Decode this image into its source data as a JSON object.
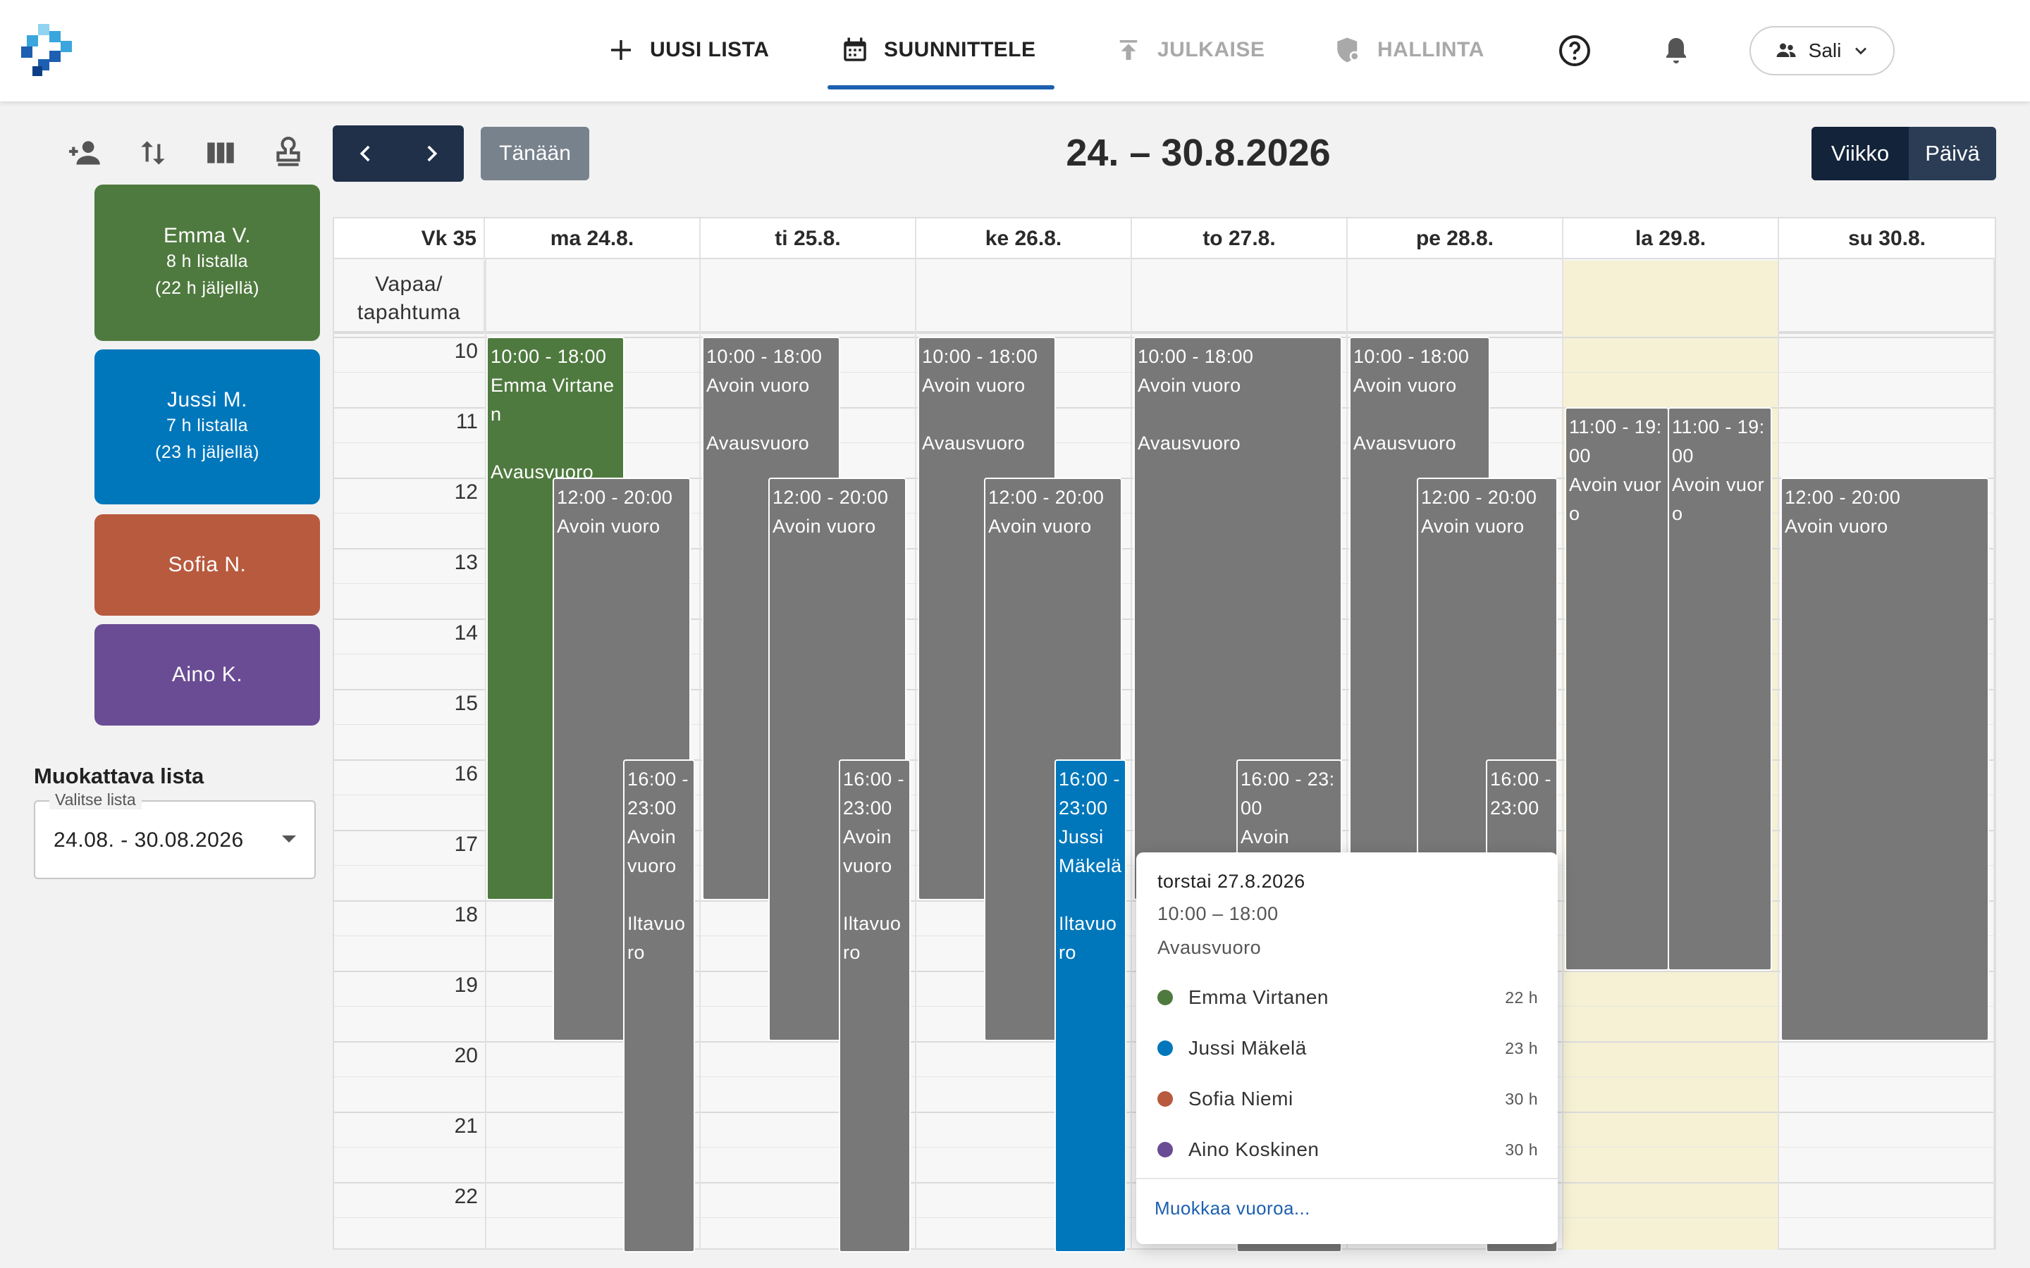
{
  "nav": {
    "new_list": "UUSI LISTA",
    "plan": "SUUNNITTELE",
    "publish": "JULKAISE",
    "admin": "HALLINTA",
    "location": "Sali"
  },
  "employees": [
    {
      "name": "Emma V.",
      "line1": "8 h listalla",
      "line2": "(22 h jäljellä)",
      "color": "#4f7a3f"
    },
    {
      "name": "Jussi M.",
      "line1": "7 h listalla",
      "line2": "(23 h jäljellä)",
      "color": "#0077bb"
    },
    {
      "name": "Sofia N.",
      "line1": "",
      "line2": "",
      "color": "#b85a3e"
    },
    {
      "name": "Aino K.",
      "line1": "",
      "line2": "",
      "color": "#6a4c94"
    }
  ],
  "list_panel": {
    "title": "Muokattava lista",
    "select_label": "Valitse lista",
    "select_value": "24.08. - 30.08.2026"
  },
  "toolbar": {
    "today": "Tänään",
    "range": "24. – 30.8.2026",
    "view_week": "Viikko",
    "view_day": "Päivä"
  },
  "calendar": {
    "week_label": "Vk 35",
    "allday_line1": "Vapaa/",
    "allday_line2": "tapahtuma",
    "days": [
      "ma 24.8.",
      "ti 25.8.",
      "ke 26.8.",
      "to 27.8.",
      "pe 28.8.",
      "la 29.8.",
      "su 30.8."
    ],
    "hours": [
      "10",
      "11",
      "12",
      "13",
      "14",
      "15",
      "16",
      "17",
      "18",
      "19",
      "20",
      "21",
      "22"
    ],
    "events": [
      {
        "day": 0,
        "time": "10:00 - 18:00",
        "title": "Emma Virtanen",
        "note": "Avausvuoro",
        "color": "green"
      },
      {
        "day": 0,
        "time": "12:00 - 20:00",
        "title": "Avoin vuoro",
        "note": "",
        "color": "gray"
      },
      {
        "day": 0,
        "time": "16:00 - 23:00",
        "title": "Avoin vuoro",
        "note": "Iltavuoro",
        "color": "gray"
      },
      {
        "day": 1,
        "time": "10:00 - 18:00",
        "title": "Avoin vuoro",
        "note": "Avausvuoro",
        "color": "gray"
      },
      {
        "day": 1,
        "time": "12:00 - 20:00",
        "title": "Avoin vuoro",
        "note": "",
        "color": "gray"
      },
      {
        "day": 1,
        "time": "16:00 - 23:00",
        "title": "Avoin vuoro",
        "note": "Iltavuoro",
        "color": "gray"
      },
      {
        "day": 2,
        "time": "10:00 - 18:00",
        "title": "Avoin vuoro",
        "note": "Avausvuoro",
        "color": "gray"
      },
      {
        "day": 2,
        "time": "12:00 - 20:00",
        "title": "Avoin vuoro",
        "note": "",
        "color": "gray"
      },
      {
        "day": 2,
        "time": "16:00 - 23:00",
        "title": "Jussi Mäkelä",
        "note": "Iltavuoro",
        "color": "blue"
      },
      {
        "day": 3,
        "time": "10:00 - 18:00",
        "title": "Avoin vuoro",
        "note": "Avausvuoro",
        "color": "gray"
      },
      {
        "day": 3,
        "time": "16:00 - 23:00",
        "title": "Avoin",
        "note": "",
        "color": "gray"
      },
      {
        "day": 4,
        "time": "10:00 - 18:00",
        "title": "Avoin vuoro",
        "note": "Avausvuoro",
        "color": "gray"
      },
      {
        "day": 4,
        "time": "12:00 - 20:00",
        "title": "Avoin vuoro",
        "note": "",
        "color": "gray"
      },
      {
        "day": 4,
        "time": "16:00 - 23:00",
        "title": "",
        "note": "",
        "color": "gray"
      },
      {
        "day": 5,
        "time": "11:00 - 19:00",
        "title": "Avoin vuoro",
        "note": "",
        "color": "gray"
      },
      {
        "day": 5,
        "time": "11:00 - 19:00",
        "title": "Avoin vuoro",
        "note": "",
        "color": "gray"
      },
      {
        "day": 6,
        "time": "12:00 - 20:00",
        "title": "Avoin vuoro",
        "note": "",
        "color": "gray"
      }
    ]
  },
  "popover": {
    "date": "torstai 27.8.2026",
    "time": "10:00 – 18:00",
    "type": "Avausvuoro",
    "employees": [
      {
        "name": "Emma Virtanen",
        "hours": "22 h",
        "color": "#4f7a3f"
      },
      {
        "name": "Jussi Mäkelä",
        "hours": "23 h",
        "color": "#0077bb"
      },
      {
        "name": "Sofia Niemi",
        "hours": "30 h",
        "color": "#b85a3e"
      },
      {
        "name": "Aino Koskinen",
        "hours": "30 h",
        "color": "#6a4c94"
      }
    ],
    "edit_link": "Muokkaa vuoroa..."
  }
}
